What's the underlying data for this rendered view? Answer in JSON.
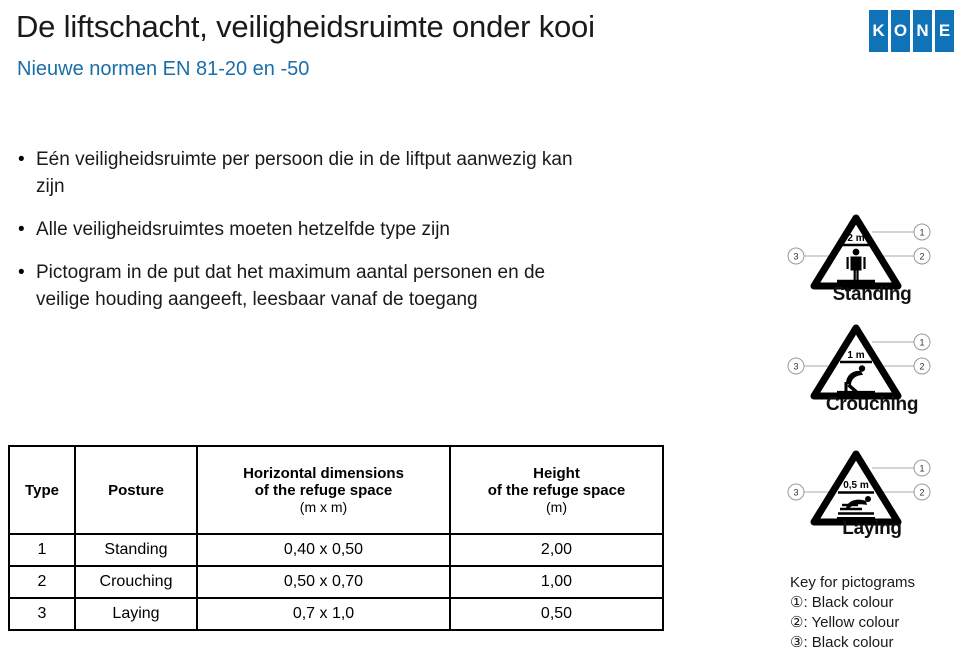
{
  "header": {
    "title": "De liftschacht, veiligheidsruimte onder kooi",
    "subtitle": "Nieuwe normen EN 81-20 en -50"
  },
  "logo": {
    "name": "KONE",
    "tiles": [
      "K",
      "O",
      "N",
      "E"
    ],
    "color": "#1073b8"
  },
  "bullets": [
    "Eén veiligheidsruimte per persoon die in de liftput aanwezig kan zijn",
    "Alle veiligheidsruimtes moeten hetzelfde type zijn",
    "Pictogram in de put dat het maximum aantal personen en de veilige houding aangeeft, leesbaar vanaf de toegang"
  ],
  "bullet_marker": "•",
  "table": {
    "headers": {
      "type": "Type",
      "posture": "Posture",
      "horizontal_line1": "Horizontal dimensions",
      "horizontal_line2": "of the refuge space",
      "horizontal_unit": "(m x m)",
      "height_line1": "Height",
      "height_line2": "of the refuge space",
      "height_unit": "(m)"
    },
    "rows": [
      {
        "type": "1",
        "posture": "Standing",
        "horizontal": "0,40 x 0,50",
        "height": "2,00"
      },
      {
        "type": "2",
        "posture": "Crouching",
        "horizontal": "0,50 x 0,70",
        "height": "1,00"
      },
      {
        "type": "3",
        "posture": "Laying",
        "horizontal": "0,7 x 1,0",
        "height": "0,50"
      }
    ]
  },
  "pictograms": [
    {
      "label": "Standing",
      "dimension": "2 m",
      "callout_top": "1",
      "callout_right": "2",
      "callout_left": "3"
    },
    {
      "label": "Crouching",
      "dimension": "1 m",
      "callout_top": "1",
      "callout_right": "2",
      "callout_left": "3"
    },
    {
      "label": "Laying",
      "dimension": "0,5 m",
      "callout_top": "1",
      "callout_right": "2",
      "callout_left": "3"
    }
  ],
  "key": {
    "title": "Key for pictograms",
    "lines": [
      "①: Black colour",
      "②: Yellow colour",
      "③: Black colour"
    ]
  }
}
